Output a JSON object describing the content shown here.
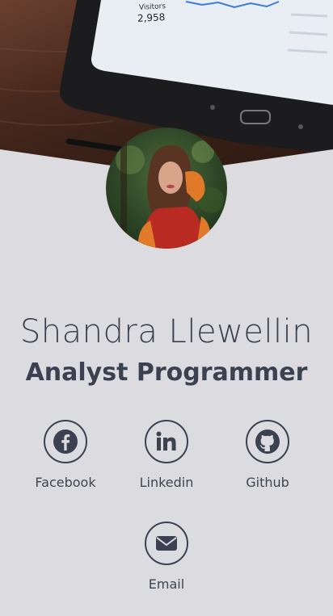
{
  "profile": {
    "name": "Shandra Llewellin",
    "title": "Analyst Programmer"
  },
  "header_image": {
    "screen_text": {
      "visitors_label": "Visitors",
      "visitors_value": "2,958"
    }
  },
  "social_links": [
    {
      "label": "Facebook",
      "icon": "facebook-icon"
    },
    {
      "label": "Linkedin",
      "icon": "linkedin-icon"
    },
    {
      "label": "Github",
      "icon": "github-icon"
    },
    {
      "label": "Email",
      "icon": "envelope-icon"
    }
  ],
  "colors": {
    "background": "#dcdce0",
    "text": "#3b4150",
    "icon": "#3b4150"
  }
}
